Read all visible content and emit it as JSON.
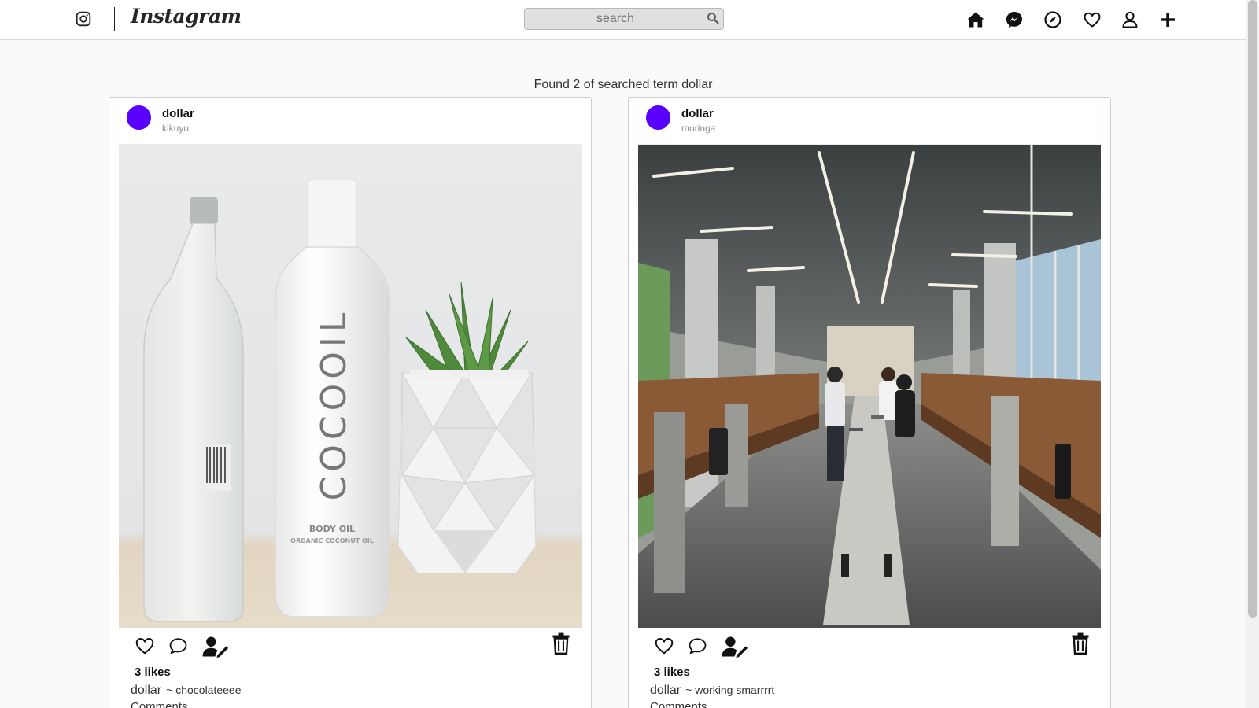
{
  "navbar": {
    "brand": "Instagram",
    "search_placeholder": "search",
    "icons": [
      "home-icon",
      "messenger-icon",
      "explore-icon",
      "activity-heart-icon",
      "profile-icon",
      "add-post-icon"
    ]
  },
  "results": {
    "prefix": "Found",
    "count": "2",
    "middle": "of searched term",
    "term": "dollar"
  },
  "posts": [
    {
      "username": "dollar",
      "location": "kikuyu",
      "image_description_icon": "product-photo-cocooil",
      "bottle_text": "COCOOIL",
      "bottle_subtext": "BODY OIL",
      "bottle_subtext2": "ORGANIC COCONUT OIL",
      "likes": "3 likes",
      "caption_user": "dollar",
      "caption_text": "~ chocolateeee",
      "comments_label": "Comments"
    },
    {
      "username": "dollar",
      "location": "moringa",
      "image_description_icon": "office-photo",
      "likes": "3 likes",
      "caption_user": "dollar",
      "caption_text": "~ working smarrrrt",
      "comments_label": "Comments"
    }
  ],
  "colors": {
    "avatar": "#5a00ff",
    "nav_border": "#dbdbdb",
    "background": "#fafafa"
  }
}
